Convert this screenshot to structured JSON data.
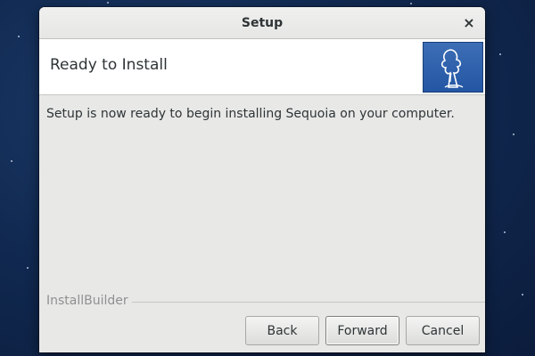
{
  "window": {
    "title": "Setup",
    "close_glyph": "×"
  },
  "header": {
    "title": "Ready to Install",
    "logo_icon": "sequoia-tree-logo"
  },
  "main": {
    "message": "Setup is now ready to begin installing Sequoia on your computer."
  },
  "footer": {
    "brand": "InstallBuilder",
    "buttons": {
      "back": "Back",
      "forward": "Forward",
      "cancel": "Cancel"
    }
  },
  "colors": {
    "desktop_bg": "#112a52",
    "window_bg": "#e8e8e7",
    "header_bg": "#ffffff",
    "logo_bg": "#2f62ad",
    "text": "#2e3436",
    "brand_text": "#8e918f"
  }
}
